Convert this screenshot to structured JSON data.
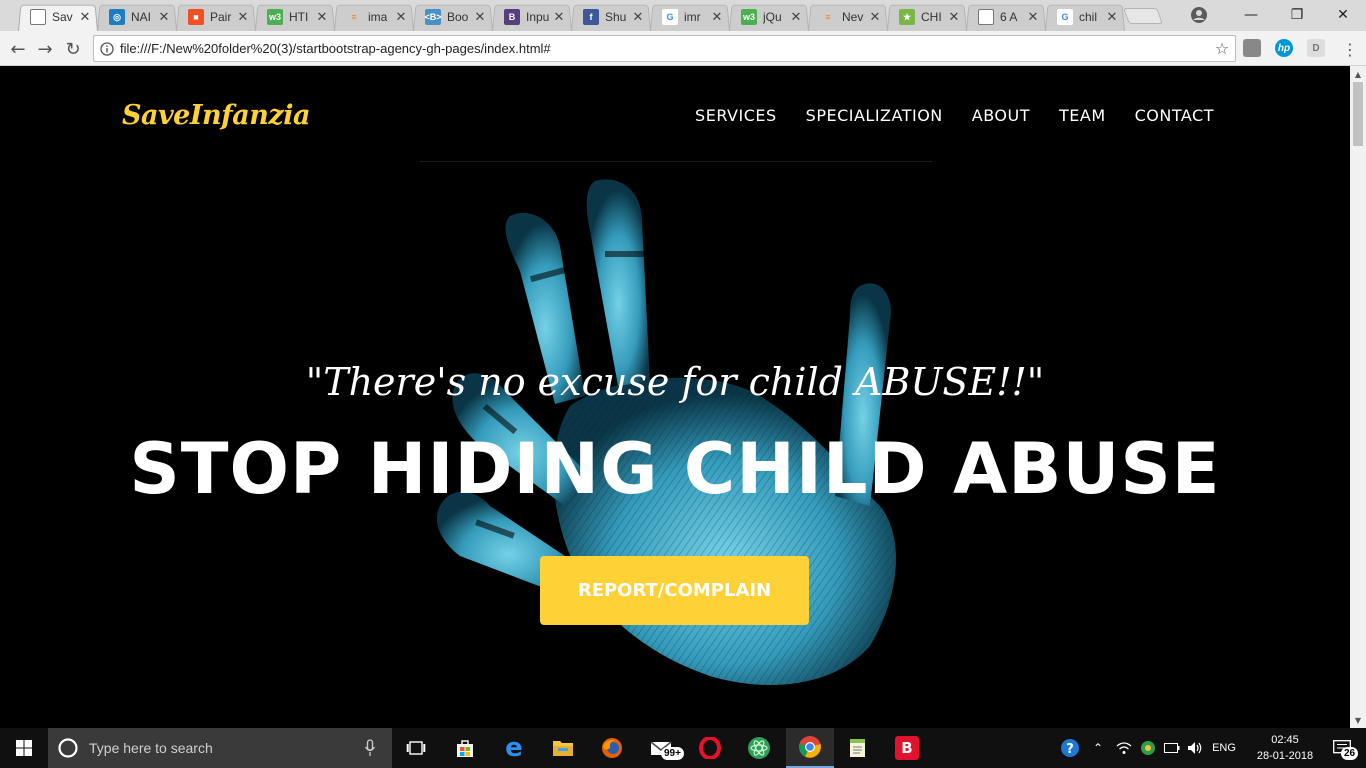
{
  "browser": {
    "tabs": [
      {
        "title": "Sav",
        "favicon": "document-icon",
        "active": true
      },
      {
        "title": "NAI",
        "favicon": "globe-icon"
      },
      {
        "title": "Pair",
        "favicon": "microsoft-icon"
      },
      {
        "title": "HTI",
        "favicon": "w3schools-icon"
      },
      {
        "title": "ima",
        "favicon": "stackoverflow-icon"
      },
      {
        "title": "Boo",
        "favicon": "bootsnipp-icon"
      },
      {
        "title": "Inpu",
        "favicon": "bootstrap-icon"
      },
      {
        "title": "Shu",
        "favicon": "facebook-icon"
      },
      {
        "title": "imr",
        "favicon": "google-icon"
      },
      {
        "title": "jQu",
        "favicon": "w3schools-icon"
      },
      {
        "title": "Nev",
        "favicon": "stackoverflow-icon"
      },
      {
        "title": "CHI",
        "favicon": "site-icon"
      },
      {
        "title": "6 A",
        "favicon": "document-icon"
      },
      {
        "title": "chil",
        "favicon": "google-icon"
      }
    ],
    "url": "file:///F:/New%20folder%20(3)/startbootstrap-agency-gh-pages/index.html#",
    "extensions": [
      {
        "name": "extension-cube-icon",
        "label": ""
      },
      {
        "name": "hp-extension-icon",
        "label": "hp"
      },
      {
        "name": "d-extension-icon",
        "label": "D"
      }
    ]
  },
  "site": {
    "brand": "SaveInfanzia",
    "nav": [
      "SERVICES",
      "SPECIALIZATION",
      "ABOUT",
      "TEAM",
      "CONTACT"
    ],
    "quote": "\"There's no excuse for child ABUSE!!\"",
    "headline": "STOP HIDING CHILD ABUSE",
    "cta": "REPORT/COMPLAIN",
    "colors": {
      "accent": "#fed136",
      "background": "#000000",
      "hand": "#5fd3f0"
    }
  },
  "taskbar": {
    "search_placeholder": "Type here to search",
    "store_badge": "99+",
    "language": "ENG",
    "time": "02:45",
    "date": "28-01-2018",
    "notification_count": "26"
  }
}
